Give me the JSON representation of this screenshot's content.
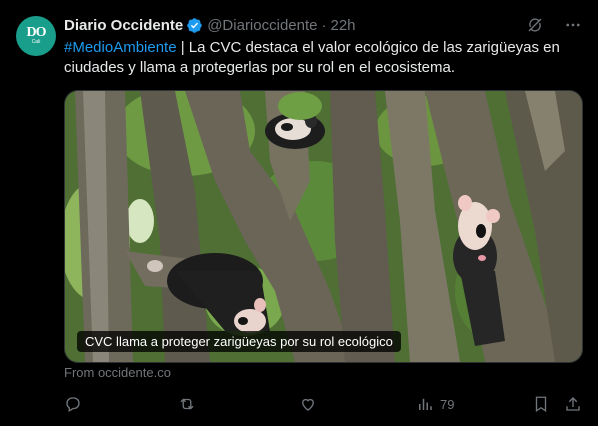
{
  "author": {
    "name": "Diario Occidente",
    "handle": "@Diarioccidente",
    "separator": "·",
    "time": "22h",
    "avatar_text": "DO",
    "avatar_sub": "Cali"
  },
  "tweet": {
    "hashtag": "#MedioAmbiente",
    "body": " | La CVC destaca el valor ecológico de las zarigüeyas en ciudades y llama a protegerlas por su rol en el ecosistema."
  },
  "media": {
    "caption": "CVC llama a proteger zarigüeyas por su rol ecológico"
  },
  "source": "From occidente.co",
  "actions": {
    "views": "79"
  },
  "colors": {
    "background": "#000000",
    "text": "#e7e9ea",
    "muted": "#71767b",
    "link": "#1d9bf0",
    "avatar": "#1a9e8c",
    "verified": "#1d9bf0"
  },
  "icons": [
    "verified-badge-icon",
    "grok-icon",
    "more-icon",
    "reply-icon",
    "retweet-icon",
    "like-icon",
    "views-icon",
    "bookmark-icon",
    "share-icon"
  ]
}
